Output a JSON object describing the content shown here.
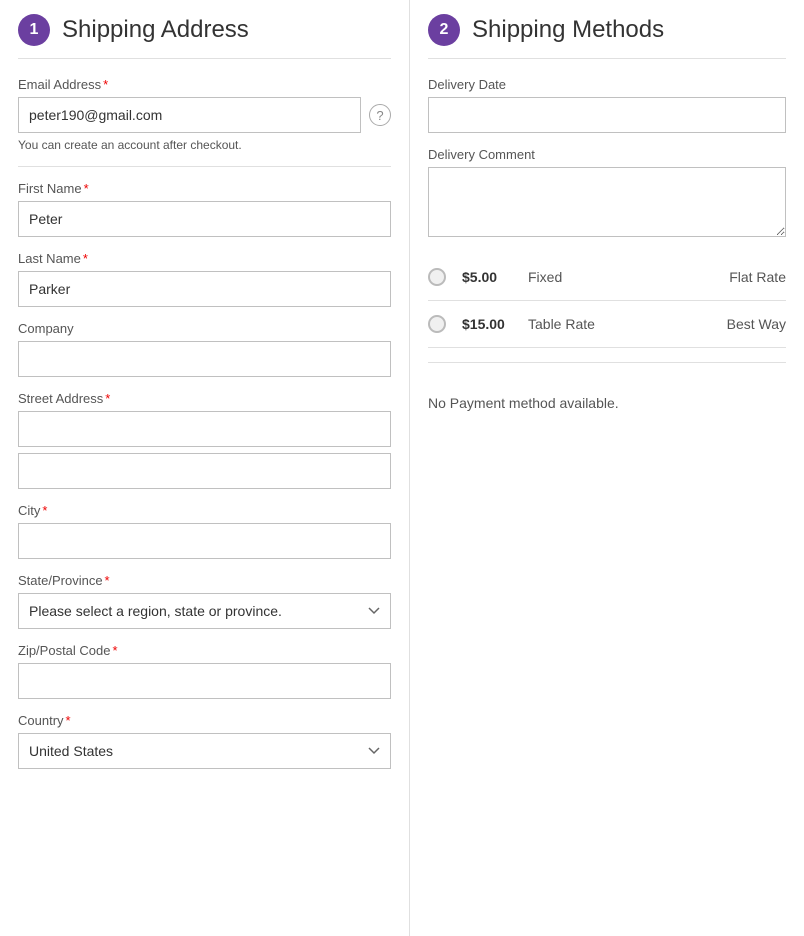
{
  "left": {
    "step": "1",
    "title": "Shipping Address",
    "email_label": "Email Address",
    "email_value": "peter190@gmail.com",
    "email_hint": "You can create an account after checkout.",
    "firstname_label": "First Name",
    "firstname_value": "Peter",
    "lastname_label": "Last Name",
    "lastname_value": "Parker",
    "company_label": "Company",
    "company_value": "",
    "street_label": "Street Address",
    "street1_value": "",
    "street2_value": "",
    "city_label": "City",
    "city_value": "",
    "state_label": "State/Province",
    "state_placeholder": "Please select a region, state or province.",
    "zip_label": "Zip/Postal Code",
    "zip_value": "",
    "country_label": "Country",
    "country_value": "United States"
  },
  "right": {
    "step": "2",
    "title": "Shipping Methods",
    "delivery_date_label": "Delivery Date",
    "delivery_date_value": "",
    "delivery_comment_label": "Delivery Comment",
    "delivery_comment_value": "",
    "methods": [
      {
        "price": "$5.00",
        "type": "Fixed",
        "name": "Flat Rate"
      },
      {
        "price": "$15.00",
        "type": "Table Rate",
        "name": "Best Way"
      }
    ],
    "no_payment_text": "No Payment method available."
  }
}
